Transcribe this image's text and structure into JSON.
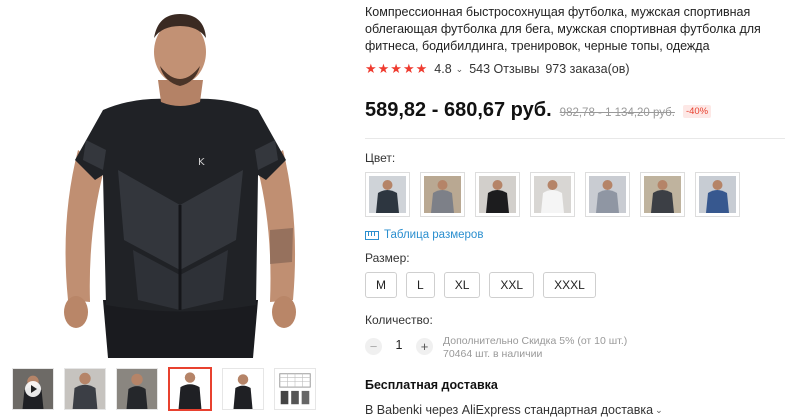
{
  "product": {
    "title": "Компрессионная быстросохнущая футболка, мужская спортивная облегающая футболка для бега, мужская спортивная футболка для фитнеса, бодибилдинга, тренировок, черные топы, одежда",
    "rating": "4.8",
    "reviews": "543 Отзывы",
    "orders": "973 заказа(ов)"
  },
  "price": {
    "current": "589,82 - 680,67 руб.",
    "old": "982,78 - 1 134,20 руб.",
    "discount": "-40%"
  },
  "colors": {
    "label": "Цвет:",
    "swatches": [
      {
        "name": "black-blue",
        "bg": "#cfd3d8",
        "shirt": "#2d3640"
      },
      {
        "name": "gray",
        "bg": "#b9a892",
        "shirt": "#7d8088"
      },
      {
        "name": "black",
        "bg": "#d2cfcb",
        "shirt": "#1c1c1e"
      },
      {
        "name": "white",
        "bg": "#d8d6d3",
        "shirt": "#f5f5f5"
      },
      {
        "name": "light-gray",
        "bg": "#c9ccd2",
        "shirt": "#8f96a3"
      },
      {
        "name": "dark-gray",
        "bg": "#bfb39e",
        "shirt": "#3c3f45"
      },
      {
        "name": "blue",
        "bg": "#c7ccd3",
        "shirt": "#37588f"
      }
    ]
  },
  "size_guide": {
    "label": "Таблица размеров",
    "icon": "ruler-icon"
  },
  "sizes": {
    "label": "Размер:",
    "options": [
      "M",
      "L",
      "XL",
      "XXL",
      "XXXL"
    ]
  },
  "quantity": {
    "label": "Количество:",
    "value": "1",
    "discount_note": "Дополнительно Скидка 5% (от 10 шт.)",
    "stock": "70464 шт. в наличии"
  },
  "shipping": {
    "title": "Бесплатная доставка",
    "method": "В Babenki через AliExpress стандартная доставка"
  },
  "colors_theme": {
    "accent": "#e8412f",
    "link": "#2b8fcf",
    "star": "#ef3b2f"
  }
}
